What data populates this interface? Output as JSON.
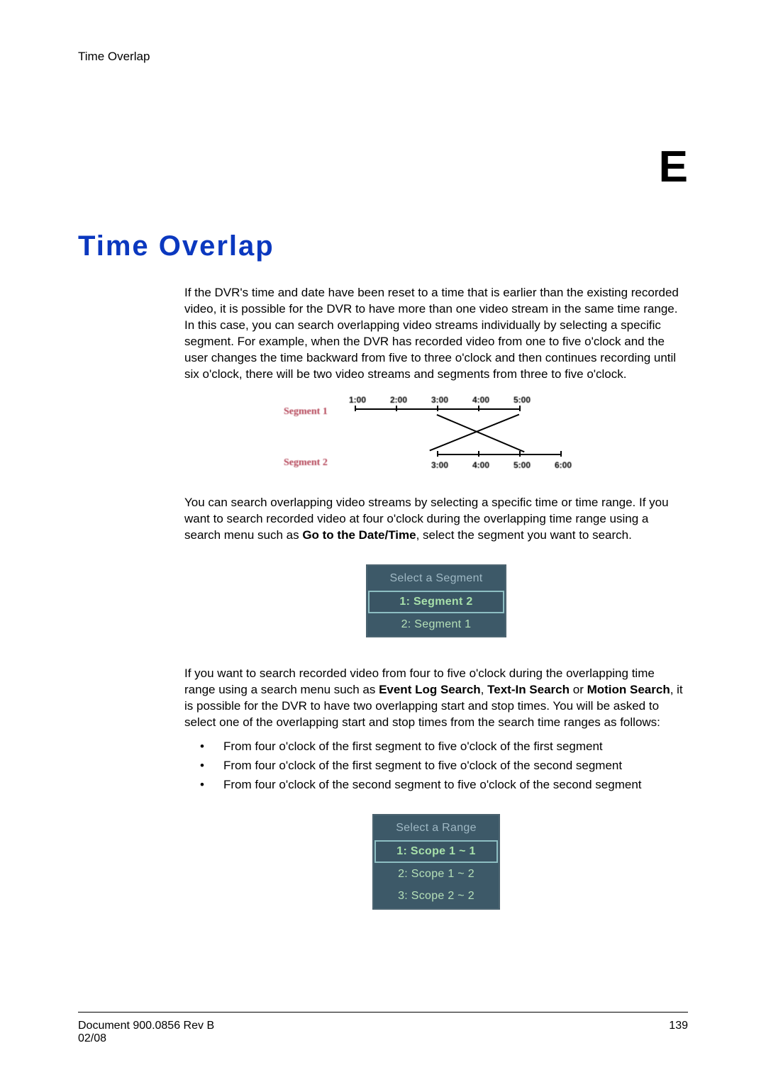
{
  "header": {
    "section_label": "Time Overlap"
  },
  "appendix_letter": "E",
  "title": "Time Overlap",
  "para1": "If the DVR's time and date have been reset to a time that is earlier than the existing recorded video, it is possible for the DVR to have more than one video stream in the same time range. In this case, you can search overlapping video streams individually by selecting a specific segment. For example, when the DVR has recorded video from one to five o'clock and the user changes the time backward from five to three o'clock and then continues recording until six o'clock, there will be two video streams and segments from three to five o'clock.",
  "segments_figure": {
    "segment1_label": "Segment 1",
    "segment2_label": "Segment 2",
    "top_ticks": [
      "1:00",
      "2:00",
      "3:00",
      "4:00",
      "5:00"
    ],
    "bottom_ticks": [
      "3:00",
      "4:00",
      "5:00",
      "6:00"
    ]
  },
  "para2_a": "You can search overlapping video streams by selecting a specific time or time range. If you want to search recorded video at four o'clock during the overlapping time range using a search menu such as ",
  "para2_bold": "Go to the Date/Time",
  "para2_b": ", select the segment you want to search.",
  "dialog_segment": {
    "title": "Select a Segment",
    "items": [
      "1: Segment 2",
      "2: Segment 1"
    ],
    "selected_index": 0
  },
  "para3_a": "If you want to search recorded video from four to five o'clock during the overlapping time range using a search menu such as ",
  "para3_bold1": "Event Log Search",
  "para3_mid1": ", ",
  "para3_bold2": "Text-In Search",
  "para3_mid2": " or ",
  "para3_bold3": "Motion Search",
  "para3_b": ", it is possible for the DVR to have two overlapping start and stop times. You will be asked to select one of the overlapping start and stop times from the search time ranges as follows:",
  "bullets": [
    "From four o'clock of the first segment to five o'clock of the first segment",
    "From four o'clock of the first segment to five o'clock of the second segment",
    "From four o'clock of the second segment to five o'clock of the second segment"
  ],
  "dialog_range": {
    "title": "Select a Range",
    "items": [
      "1: Scope 1 ~ 1",
      "2: Scope 1 ~ 2",
      "3: Scope 2 ~ 2"
    ],
    "selected_index": 0
  },
  "footer": {
    "doc_id": "Document 900.0856 Rev B",
    "date": "02/08",
    "page": "139"
  }
}
